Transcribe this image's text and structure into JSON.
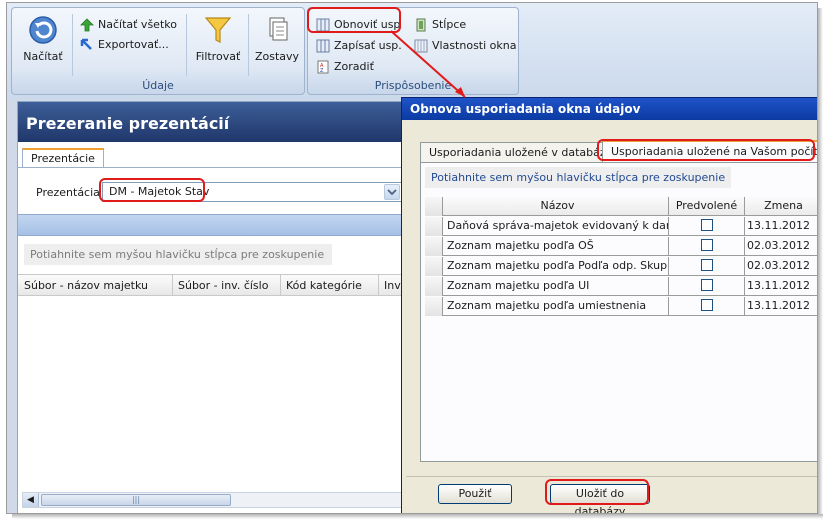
{
  "ribbon": {
    "data_group": {
      "label": "Údaje",
      "load_button": "Načítať",
      "load_all": "Načítať všetko",
      "export": "Exportovať...",
      "filter_button": "Filtrovať",
      "reports_button": "Zostavy"
    },
    "customize_group": {
      "label": "Prispôsobenie",
      "refresh_layout": "Obnoviť usp",
      "write_layout": "Zapísať usp.",
      "sort": "Zoradiť",
      "columns": "Stĺpce",
      "window_properties": "Vlastnosti okna"
    }
  },
  "left_panel": {
    "title": "Prezeranie prezentácií",
    "tab": "Prezentácie",
    "presentation_label": "Prezentácia",
    "presentation_value": "DM - Majetok Stav",
    "grouping_hint": "Potiahnite sem myšou hlavičku stĺpca pre zoskupenie",
    "columns": [
      "Súbor - názov majetku",
      "Súbor - inv. číslo",
      "Kód kategórie",
      "Inv"
    ]
  },
  "dialog": {
    "title": "Obnova usporiadania okna údajov",
    "tabs": [
      "Usporiadania uložené v databáze",
      "Usporiadania uložené na Vašom počítači"
    ],
    "grouping_hint": "Potiahnite sem myšou hlavičku stĺpca pre zoskupenie",
    "grid": {
      "headers": [
        "Názov",
        "Predvolené",
        "Zmena"
      ],
      "rows": [
        {
          "name": "Daňová správa-majetok evidovaný k dané",
          "default": false,
          "changed": "13.11.2012"
        },
        {
          "name": "Zoznam majetku podľa OŠ",
          "default": false,
          "changed": "02.03.2012"
        },
        {
          "name": "Zoznam majetku podľa Podľa odp. Skupín",
          "default": false,
          "changed": "02.03.2012"
        },
        {
          "name": "Zoznam majetku podľa UI",
          "default": false,
          "changed": "13.11.2012"
        },
        {
          "name": "Zoznam majetku podľa umiestnenia",
          "default": false,
          "changed": "13.11.2012"
        }
      ]
    },
    "buttons": {
      "apply": "Použiť",
      "save": "Uložiť do databázy"
    }
  },
  "colors": {
    "title_bar": "#0b3aa2",
    "panel_header": "#20376a",
    "ribbon": "#dfe8f4",
    "dialog_bg": "#ece9d8",
    "highlight": "#e11a1a"
  }
}
